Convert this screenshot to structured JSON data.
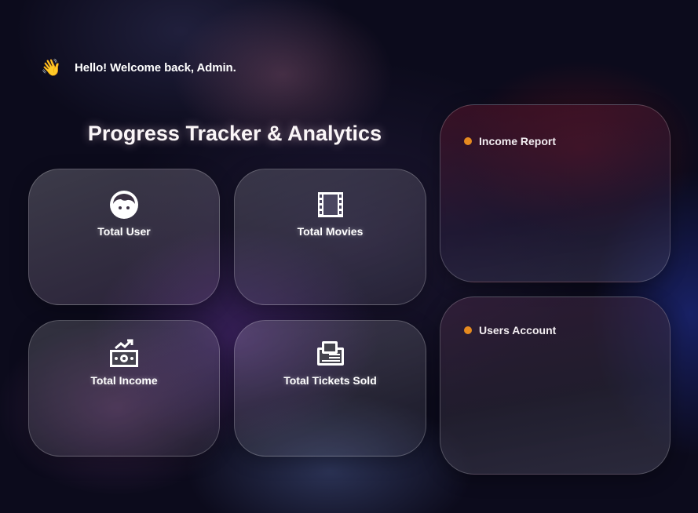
{
  "header": {
    "wave_icon": "waving-hand",
    "greeting": "Hello! Welcome back, Admin."
  },
  "dashboard": {
    "title": "Progress Tracker & Analytics",
    "cards": [
      {
        "label": "Total User",
        "icon": "user-face-icon"
      },
      {
        "label": "Total Movies",
        "icon": "film-strip-icon"
      },
      {
        "label": "Total Income",
        "icon": "money-growth-icon"
      },
      {
        "label": "Total Tickets Sold",
        "icon": "ticket-icon"
      }
    ]
  },
  "panels": {
    "income_report": {
      "title": "Income Report"
    },
    "users_account": {
      "title": "Users Account"
    }
  },
  "colors": {
    "background": "#0c0b1c",
    "accent_dot": "#e58a1f",
    "text": "#ffffff"
  }
}
